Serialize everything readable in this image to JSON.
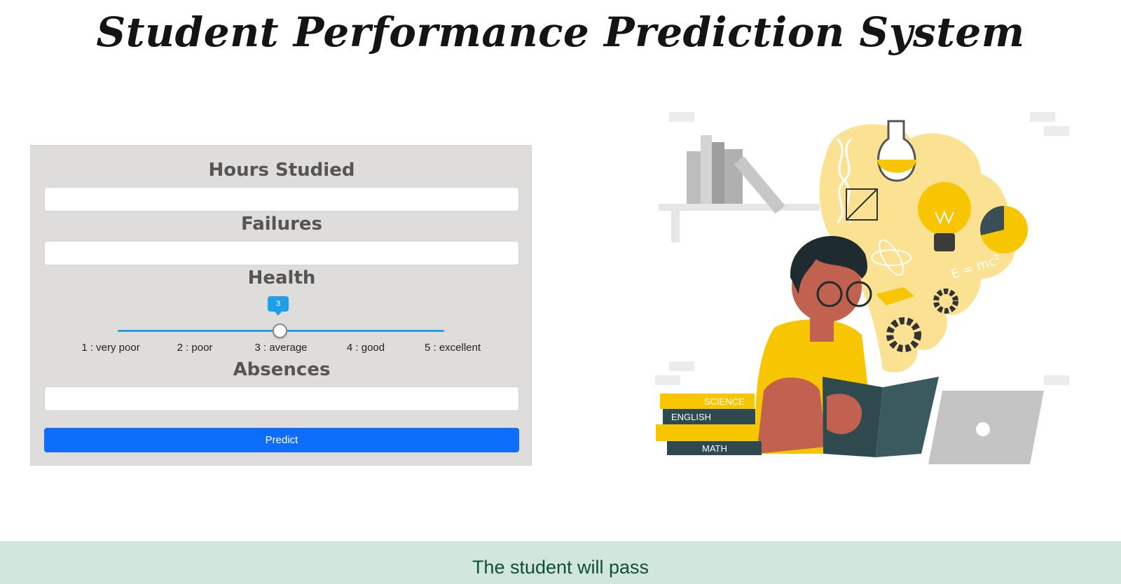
{
  "page": {
    "title": "Student Performance Prediction System"
  },
  "form": {
    "hours_studied": {
      "label": "Hours Studied",
      "value": "",
      "placeholder": ""
    },
    "failures": {
      "label": "Failures",
      "value": "",
      "placeholder": ""
    },
    "health": {
      "label": "Health",
      "value": "3",
      "value_fraction": 0.5,
      "ticks": [
        "1 : very poor",
        "2 : poor",
        "3 : average",
        "4 : good",
        "5 : excellent"
      ]
    },
    "absences": {
      "label": "Absences",
      "value": "",
      "placeholder": ""
    },
    "predict_label": "Predict"
  },
  "result": {
    "message": "The student will pass"
  },
  "colors": {
    "accent": "#0d6efd",
    "slider": "#1f9fe8",
    "panel": "#dedddc",
    "illustration_yellow": "#f7c600",
    "result_bg": "#d1e7dd",
    "result_text": "#0f5132"
  },
  "illustration": {
    "book_labels": [
      "SCIENCE",
      "ENGLISH",
      "MATH"
    ],
    "formula": "E = mc²"
  }
}
